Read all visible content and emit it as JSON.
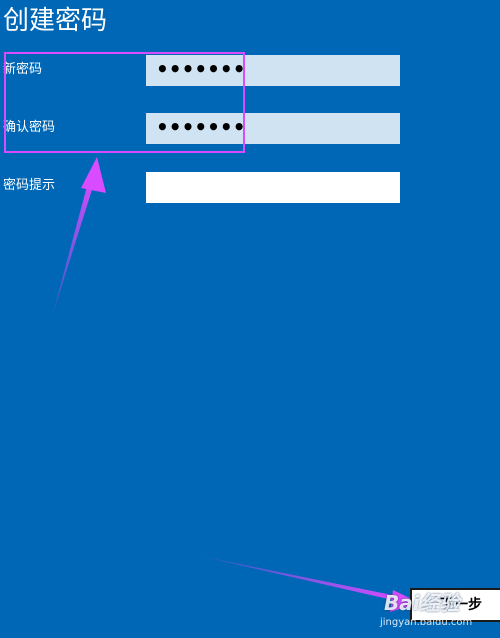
{
  "page": {
    "title": "创建密码"
  },
  "fields": [
    {
      "label": "新密码",
      "value": "•••••••"
    },
    {
      "label": "确认密码",
      "value": "•••••••"
    },
    {
      "label": "密码提示",
      "value": ""
    }
  ],
  "footer": {
    "next_label": "下一步"
  },
  "watermark": {
    "logo": "Bai经验",
    "url": "jingyan.baidu.com"
  },
  "colors": {
    "background": "#0067b6",
    "input_filled": "#cfe3f3",
    "annotation": "#d84bff"
  }
}
